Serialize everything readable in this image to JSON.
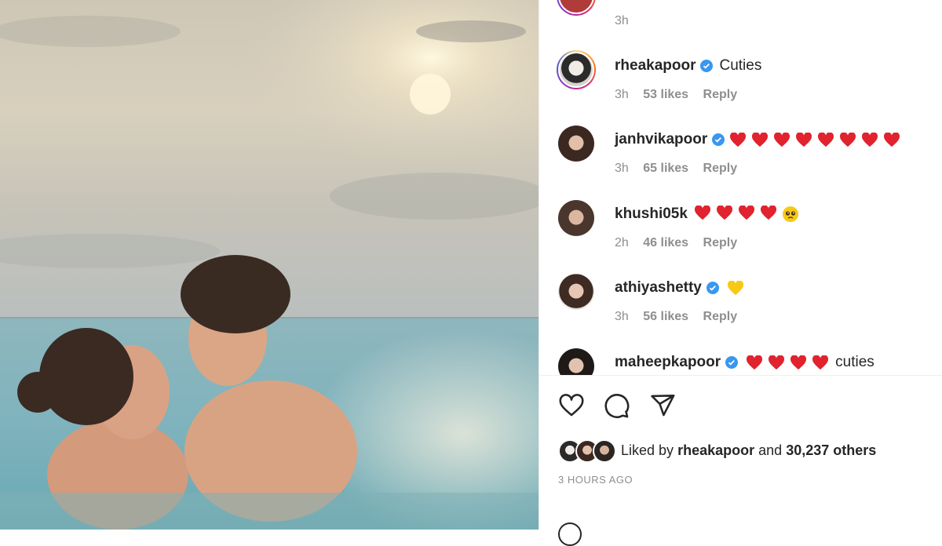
{
  "colors": {
    "heart": "#e0232e",
    "verified": "#3897f0",
    "muted": "#8e8e8e",
    "text": "#262626",
    "yellow_heart": "#f6c915"
  },
  "top_partial": {
    "time": "3h"
  },
  "comments": [
    {
      "user": "rheakapoor",
      "verified": true,
      "text": "Cuties",
      "heart_count": 0,
      "time": "3h",
      "likes": "53 likes",
      "reply": "Reply",
      "avatar_ring": true
    },
    {
      "user": "janhvikapoor",
      "verified": true,
      "text": "",
      "heart_count": 8,
      "time": "3h",
      "likes": "65 likes",
      "reply": "Reply",
      "avatar_ring": false
    },
    {
      "user": "khushi05k",
      "verified": false,
      "text": "",
      "heart_count": 4,
      "emoji": "pleading-face",
      "time": "2h",
      "likes": "46 likes",
      "reply": "Reply",
      "avatar_ring": false
    },
    {
      "user": "athiyashetty",
      "verified": true,
      "text": "",
      "heart_count": 0,
      "emoji": "yellow-heart",
      "time": "3h",
      "likes": "56 likes",
      "reply": "Reply",
      "avatar_ring": false
    },
    {
      "user": "maheepkapoor",
      "verified": true,
      "text": "cuties",
      "heart_count": 4,
      "time": "",
      "likes": "",
      "reply": "",
      "avatar_ring": false
    }
  ],
  "actions": {
    "icons": [
      "heart-outline-icon",
      "comment-icon",
      "share-icon"
    ]
  },
  "likes": {
    "prefix": "Liked by",
    "user": "rheakapoor",
    "middle": "and",
    "count": "30,237 others"
  },
  "timestamp": "3 HOURS AGO"
}
